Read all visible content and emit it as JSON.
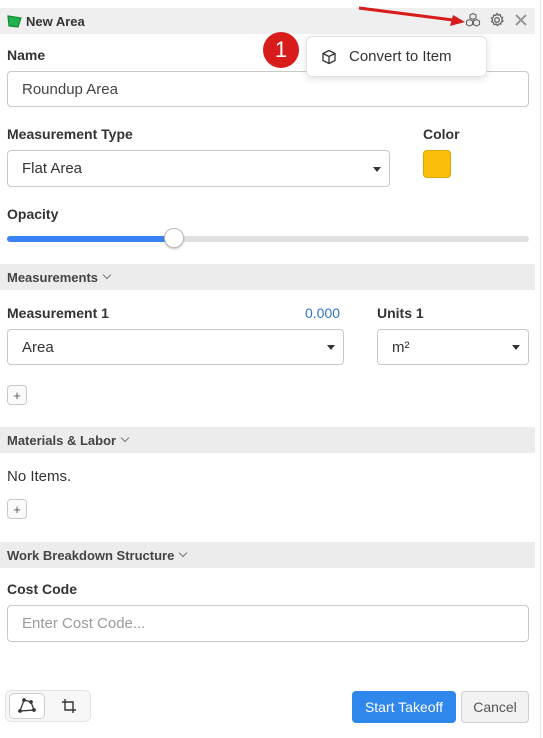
{
  "header": {
    "title": "New Area"
  },
  "name": {
    "label": "Name",
    "value": "Roundup Area"
  },
  "measurement_type": {
    "label": "Measurement Type",
    "value": "Flat Area"
  },
  "color": {
    "label": "Color",
    "value": "#fbbf09"
  },
  "opacity": {
    "label": "Opacity",
    "value_percent": 32
  },
  "sections": {
    "measurements": "Measurements",
    "materials": "Materials & Labor",
    "wbs": "Work Breakdown Structure"
  },
  "measurement1": {
    "label": "Measurement 1",
    "value": "0.000",
    "type": "Area"
  },
  "units1": {
    "label": "Units 1",
    "value": "m²"
  },
  "add_label": "+",
  "materials": {
    "empty_text": "No Items."
  },
  "cost_code": {
    "label": "Cost Code",
    "placeholder": "Enter Cost Code..."
  },
  "footer": {
    "start_label": "Start Takeoff",
    "cancel_label": "Cancel"
  },
  "menu": {
    "item_label": "Convert to Item"
  },
  "annotation": {
    "badge": "1"
  },
  "colors": {
    "accent": "#2f86eb",
    "annotation": "#d81b1b",
    "area_icon": "#22b14c"
  },
  "icons": [
    "polygon-area-icon",
    "cubes-icon",
    "gear-icon",
    "close-icon",
    "cube-icon",
    "polygon-tool-icon",
    "crop-tool-icon"
  ]
}
